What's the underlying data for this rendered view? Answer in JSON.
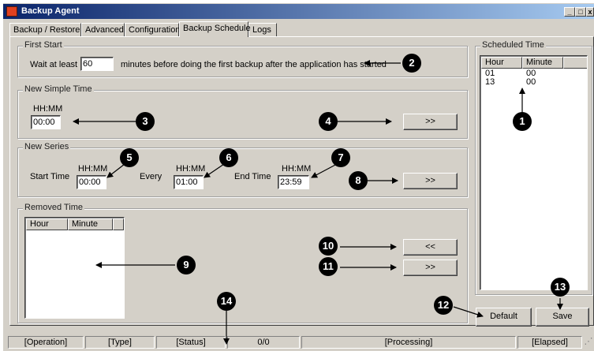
{
  "window": {
    "title": "Backup Agent"
  },
  "title_buttons": {
    "minimize": "_",
    "maximize": "□",
    "close": "x"
  },
  "tabs": [
    {
      "label": "Backup / Restore"
    },
    {
      "label": "Advanced"
    },
    {
      "label": "Configuration"
    },
    {
      "label": "Backup Schedule"
    },
    {
      "label": "Logs"
    }
  ],
  "first_start": {
    "legend": "First Start",
    "wait_label": "Wait at least",
    "minutes_value": "60",
    "suffix_text": "minutes before doing the first backup after the application has started"
  },
  "new_simple_time": {
    "legend": "New Simple Time",
    "format_label": "HH:MM",
    "value": "00:00",
    "add_button": ">>"
  },
  "new_series": {
    "legend": "New Series",
    "start_label": "Start Time",
    "every_label": "Every",
    "end_label": "End Time",
    "format_label": "HH:MM",
    "start_value": "00:00",
    "every_value": "01:00",
    "end_value": "23:59",
    "add_button": ">>"
  },
  "removed_time": {
    "legend": "Removed Time",
    "columns": [
      "Hour",
      "Minute"
    ],
    "rows": [],
    "restore_button": "<<",
    "remove_button": ">>"
  },
  "scheduled_time": {
    "legend": "Scheduled Time",
    "columns": [
      "Hour",
      "Minute"
    ],
    "rows": [
      [
        "01",
        "00"
      ],
      [
        "13",
        "00"
      ]
    ]
  },
  "actions": {
    "default_button": "Default",
    "save_button": "Save"
  },
  "status_bar": {
    "operation": "[Operation]",
    "type": "[Type]",
    "status": "[Status]",
    "progress": "0/0",
    "processing": "[Processing]",
    "elapsed": "[Elapsed]"
  },
  "markers": [
    "1",
    "2",
    "3",
    "4",
    "5",
    "6",
    "7",
    "8",
    "9",
    "10",
    "11",
    "12",
    "13",
    "14"
  ]
}
